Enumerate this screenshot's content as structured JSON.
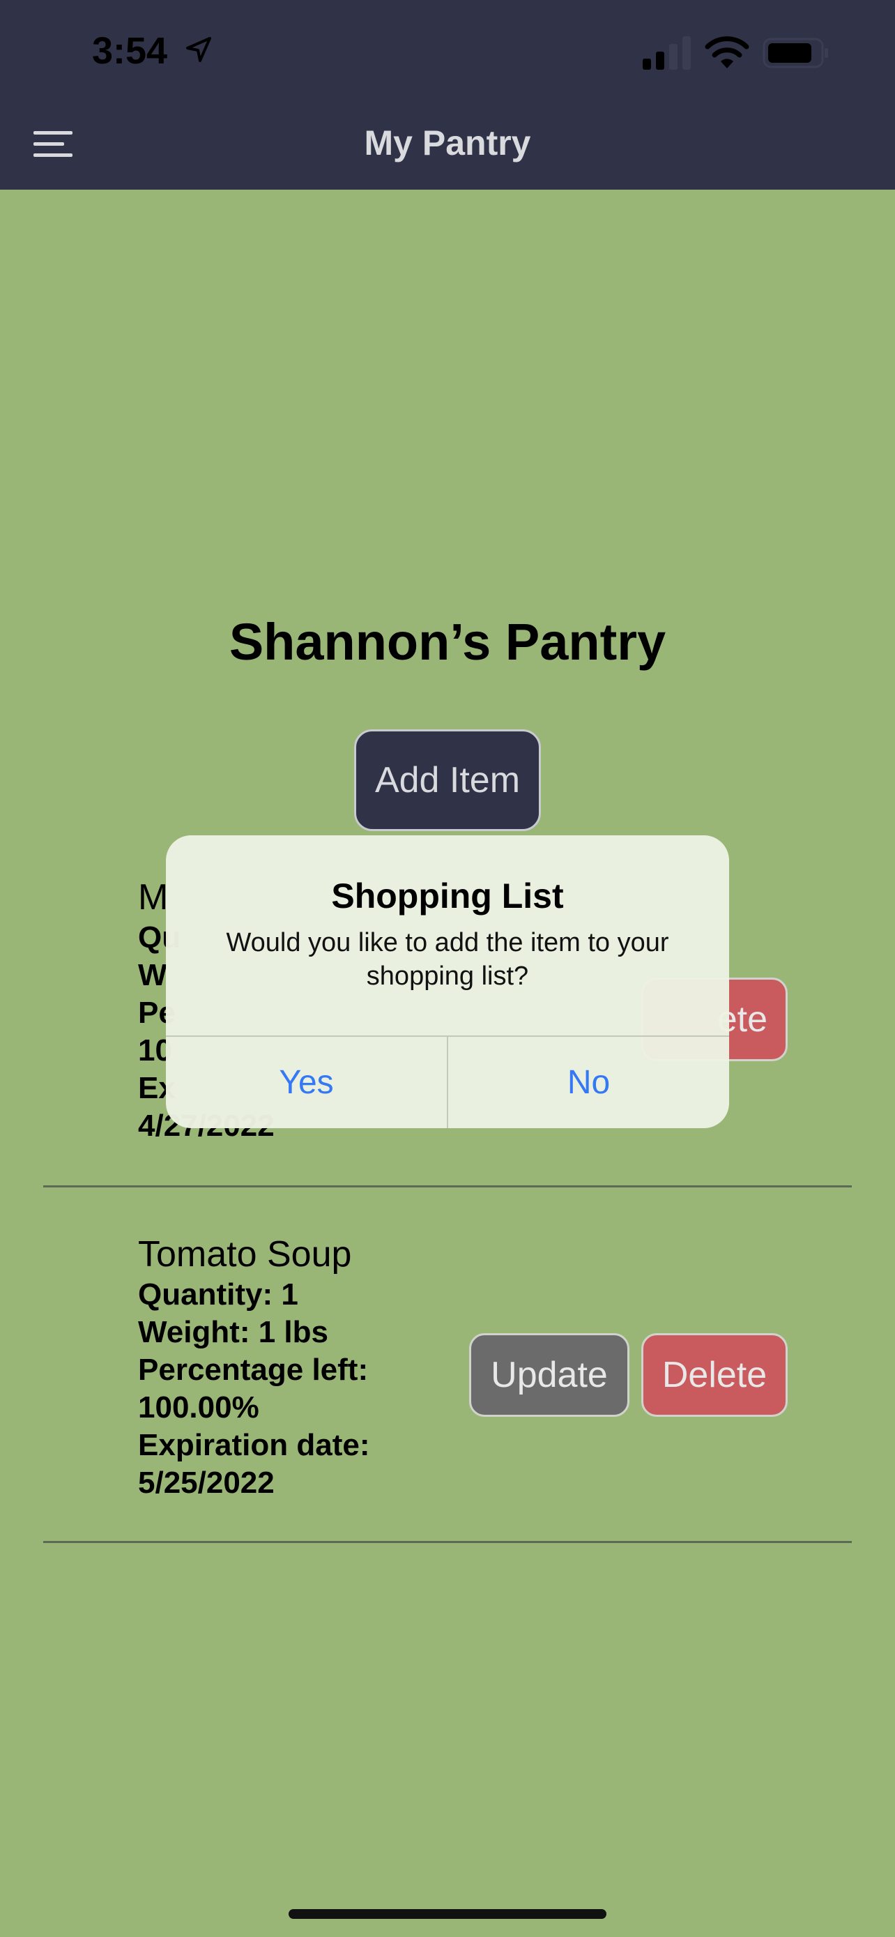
{
  "status_bar": {
    "time": "3:54"
  },
  "nav": {
    "title": "My Pantry"
  },
  "pantry": {
    "title": "Shannon’s Pantry",
    "add_item_label": "Add Item"
  },
  "items": [
    {
      "name": "M",
      "lines": [
        "Qu",
        "W",
        "Pe",
        "10",
        "Ex",
        "4/27/2022"
      ],
      "delete_label": "ete"
    },
    {
      "name": "Tomato Soup",
      "lines": [
        "Quantity: 1",
        "Weight: 1 lbs",
        "Percentage left:",
        "100.00%",
        "Expiration date:",
        "5/25/2022"
      ],
      "update_label": "Update",
      "delete_label": "Delete"
    }
  ],
  "alert": {
    "title": "Shopping List",
    "message": "Would you like to add the item to your shopping list?",
    "yes_label": "Yes",
    "no_label": "No"
  },
  "colors": {
    "background": "#9ab677",
    "nav_bar": "#303247",
    "update_button": "#6b6b6b",
    "delete_button": "#c95b5e",
    "alert_action": "#3478f6"
  }
}
